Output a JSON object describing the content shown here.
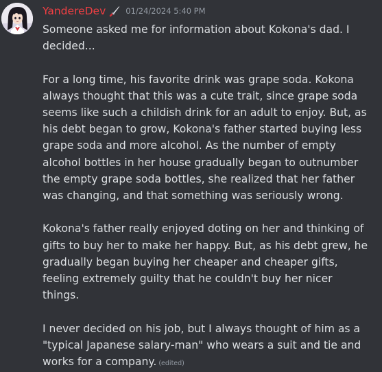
{
  "message": {
    "username": "YandereDev",
    "role_icon": "knife-icon",
    "timestamp": "01/24/2024 5:40 PM",
    "paragraphs": [
      "Someone asked me for information about Kokona's dad. I decided...",
      "For a long time, his favorite drink was grape soda. Kokona always thought that this was a cute trait, since grape soda seems like such a childish drink for an adult to enjoy. But, as his debt began to grow, Kokona's father started buying less grape soda and more alcohol. As the number of empty alcohol bottles in her house gradually began to outnumber the empty grape soda bottles, she realized that her father was changing, and that something was seriously wrong.",
      "Kokona's father really enjoyed doting on her and thinking of gifts to buy her to make her happy. But, as his debt grew, he gradually began buying her cheaper and cheaper gifts, feeling extremely guilty that he couldn't buy her nicer things.",
      "I never decided on his job, but I always thought of him as a \"typical Japanese salary-man\" who wears a suit and tie and works for a company."
    ],
    "edited_label": "(edited)"
  },
  "colors": {
    "background": "#313338",
    "username": "#f23f43",
    "text": "#dbdee1",
    "muted": "#949ba4"
  }
}
